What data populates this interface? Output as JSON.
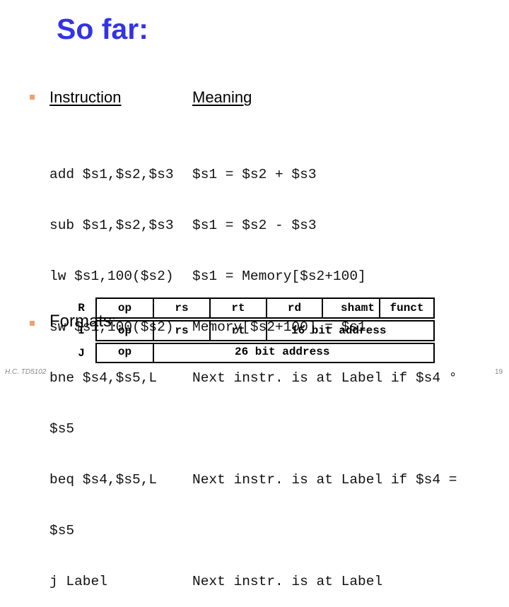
{
  "slide": {
    "title": "So far:",
    "headings": {
      "instruction": "Instruction",
      "meaning": "Meaning"
    },
    "instructions": [
      {
        "code": "add $s1,$s2,$s3",
        "meaning": "$s1 = $s2 + $s3"
      },
      {
        "code": "sub $s1,$s2,$s3",
        "meaning": "$s1 = $s2 - $s3"
      },
      {
        "code": "lw $s1,100($s2)",
        "meaning": "$s1 = Memory[$s2+100]"
      },
      {
        "code": "sw $s1,100($s2)",
        "meaning": "Memory[$s2+100] = $s1"
      },
      {
        "code": "bne $s4,$s5,L",
        "meaning": "Next instr. is at Label if $s4 °"
      },
      {
        "code": "$s5",
        "meaning": ""
      },
      {
        "code": "beq $s4,$s5,L",
        "meaning": "Next instr. is at Label if $s4 ="
      },
      {
        "code": "$s5",
        "meaning": ""
      },
      {
        "code": "j Label",
        "meaning": "Next instr. is at Label"
      }
    ],
    "formats_label": "Formats:",
    "formats": {
      "R": {
        "letter": "R",
        "fields": [
          "op",
          "rs",
          "rt",
          "rd",
          "shamt",
          "funct"
        ]
      },
      "I": {
        "letter": "I",
        "fields": [
          "op",
          "rs",
          "rt",
          "16 bit address"
        ]
      },
      "J": {
        "letter": "J",
        "fields": [
          "op",
          "26 bit address"
        ]
      }
    },
    "footer": "H.C. TD5102",
    "page_number": "19",
    "colors": {
      "title": "#3333e6",
      "bullet": "#f0a070",
      "footer": "#888888"
    }
  }
}
